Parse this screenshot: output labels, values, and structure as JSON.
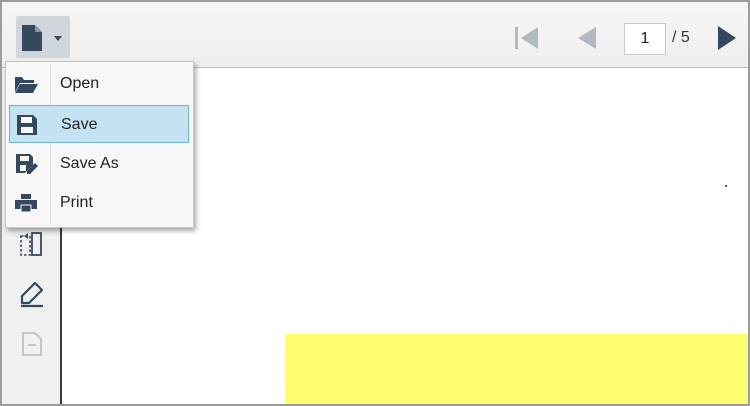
{
  "toolbar": {
    "file_icon": "file-icon",
    "page_current": "1",
    "page_total": "/ 5",
    "nav_icons": [
      "first-page-icon",
      "previous-page-icon",
      "next-page-icon"
    ]
  },
  "file_menu": {
    "items": [
      {
        "label": "Open",
        "icon": "folder-open-icon"
      },
      {
        "label": "Save",
        "icon": "save-icon",
        "selected": true
      },
      {
        "label": "Save As",
        "icon": "save-as-icon"
      },
      {
        "label": "Print",
        "icon": "print-icon"
      }
    ]
  },
  "sidebar": {
    "icons": [
      "page-select-icon",
      "signature-pen-icon",
      "blank-page-icon"
    ]
  },
  "colors": {
    "accent": "#35495e",
    "selection": "#c5e2f2",
    "highlight": "#ffff6e"
  }
}
